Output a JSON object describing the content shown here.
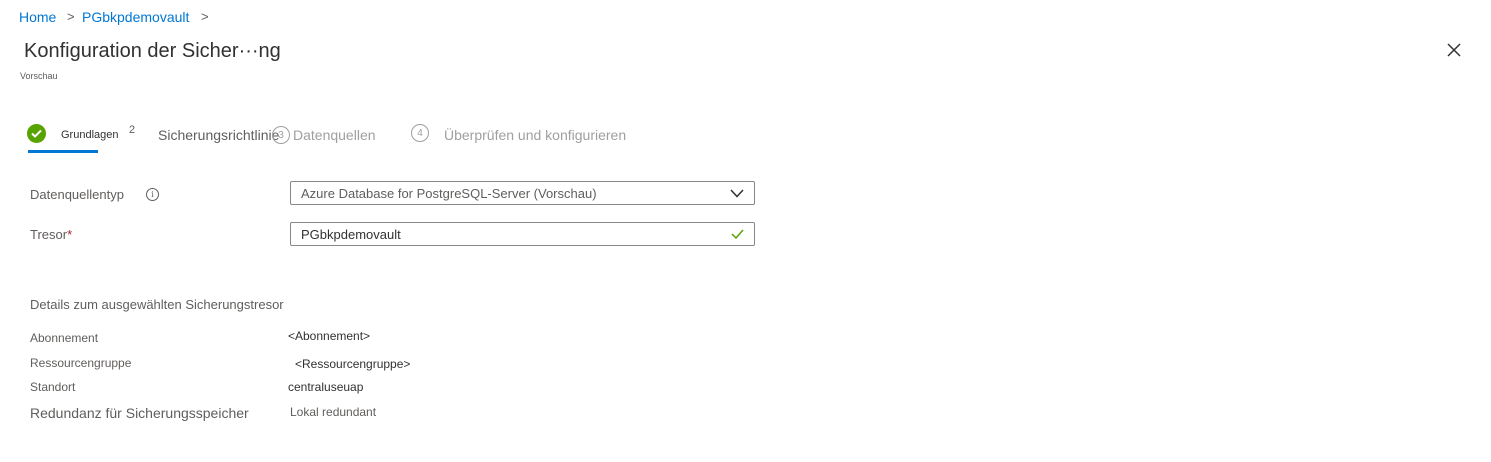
{
  "breadcrumb": {
    "items": [
      "Home",
      "PGbkpdemovault"
    ],
    "separator": ">"
  },
  "header": {
    "title": "Konfiguration der Sicher···ng",
    "subtitle": "Vorschau",
    "close_icon": "close-icon"
  },
  "wizard": {
    "steps": [
      {
        "number": "✔",
        "label": "Grundlagen",
        "state": "completed"
      },
      {
        "number": "2",
        "label": "Sicherungsrichtlinie",
        "state": "pending"
      },
      {
        "number": "3",
        "label": "Datenquellen",
        "state": "pending"
      },
      {
        "number": "4",
        "label": "Überprüfen und konfigurieren",
        "state": "pending"
      }
    ]
  },
  "form": {
    "datasource_type": {
      "label": "Datenquellentyp",
      "value": "Azure Database for PostgreSQL-Server (Vorschau)"
    },
    "vault": {
      "label": "Tresor",
      "required_marker": "*",
      "value": "PGbkpdemovault"
    }
  },
  "details": {
    "heading": "Details zum ausgewählten Sicherungstresor",
    "rows": [
      {
        "label": "Abonnement",
        "value": "<Abonnement>"
      },
      {
        "label": "Ressourcengruppe",
        "value": "<Ressourcengruppe>"
      },
      {
        "label": "Standort",
        "value": "centraluseuap"
      },
      {
        "label": "Redundanz für Sicherungsspeicher",
        "value": "Lokal redundant"
      }
    ]
  },
  "colors": {
    "accent": "#0078d4",
    "success": "#57a300",
    "required": "#a4262c"
  }
}
